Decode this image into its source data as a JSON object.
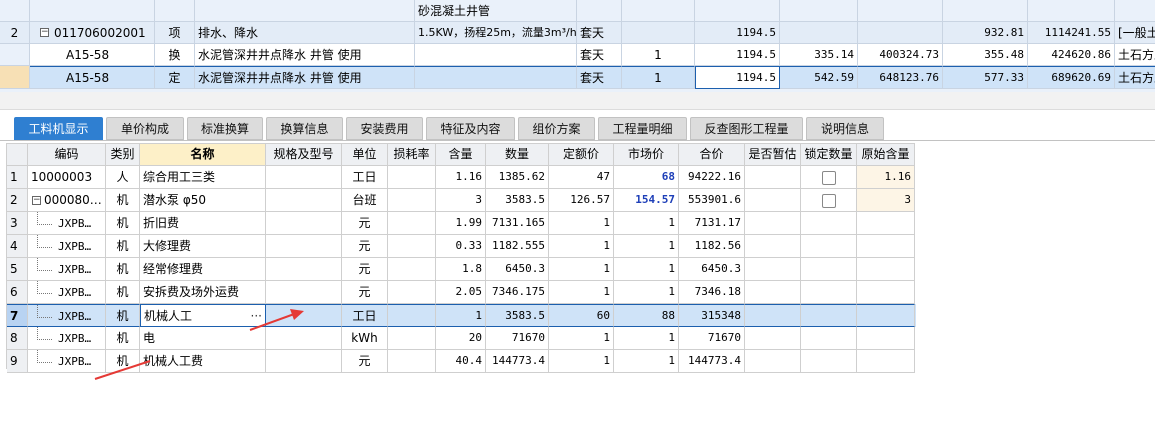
{
  "top_grid": {
    "partial_row": {
      "desc": "砂混凝土井管"
    },
    "rows": [
      {
        "num": "2",
        "code": "011706002001",
        "type": "项",
        "name": "排水、降水",
        "desc": "1.5KW，扬程25m，流量3m³/h",
        "unit": "套天",
        "qty": "",
        "amount": "1194.5",
        "c1": "",
        "c2": "",
        "c3": "932.81",
        "c4": "1114241.55",
        "c5": "[一般土"
      },
      {
        "num": "",
        "code": "A15-58",
        "type": "换",
        "name": "水泥管深井井点降水 井管 使用",
        "desc": "",
        "unit": "套天",
        "qty": "1",
        "amount": "1194.5",
        "c1": "335.14",
        "c2": "400324.73",
        "c3": "355.48",
        "c4": "424620.86",
        "c5": "土石方工"
      },
      {
        "num": "",
        "code": "A15-58",
        "type": "定",
        "name": "水泥管深井井点降水 井管 使用",
        "desc": "",
        "unit": "套天",
        "qty": "1",
        "amount": "1194.5",
        "c1": "542.59",
        "c2": "648123.76",
        "c3": "577.33",
        "c4": "689620.69",
        "c5": "土石方工"
      }
    ]
  },
  "tabs": [
    "工料机显示",
    "单价构成",
    "标准换算",
    "换算信息",
    "安装费用",
    "特征及内容",
    "组价方案",
    "工程量明细",
    "反查图形工程量",
    "说明信息"
  ],
  "active_tab": 0,
  "table": {
    "headers": [
      "编码",
      "类别",
      "名称",
      "规格及型号",
      "单位",
      "损耗率",
      "含量",
      "数量",
      "定额价",
      "市场价",
      "合价",
      "是否暂估",
      "锁定数量",
      "原始含量"
    ],
    "rows": [
      {
        "num": "1",
        "code": "10000003",
        "type": "人",
        "name": "综合用工三类",
        "spec": "",
        "unit": "工日",
        "loss": "",
        "content": "1.16",
        "qty": "1385.62",
        "base": "47",
        "market": "68",
        "total": "94222.16",
        "temp": "",
        "lock": true,
        "orig": "1.16"
      },
      {
        "num": "2",
        "code": "000080…",
        "type": "机",
        "name": "潜水泵 φ50",
        "spec": "",
        "unit": "台班",
        "loss": "",
        "content": "3",
        "qty": "3583.5",
        "base": "126.57",
        "market": "154.57",
        "total": "553901.6",
        "temp": "",
        "lock": true,
        "orig": "3"
      },
      {
        "num": "3",
        "code": "JXPB…",
        "type": "机",
        "name": "折旧费",
        "spec": "",
        "unit": "元",
        "loss": "",
        "content": "1.99",
        "qty": "7131.165",
        "base": "1",
        "market": "1",
        "total": "7131.17",
        "temp": "",
        "lock": false,
        "orig": ""
      },
      {
        "num": "4",
        "code": "JXPB…",
        "type": "机",
        "name": "大修理费",
        "spec": "",
        "unit": "元",
        "loss": "",
        "content": "0.33",
        "qty": "1182.555",
        "base": "1",
        "market": "1",
        "total": "1182.56",
        "temp": "",
        "lock": false,
        "orig": ""
      },
      {
        "num": "5",
        "code": "JXPB…",
        "type": "机",
        "name": "经常修理费",
        "spec": "",
        "unit": "元",
        "loss": "",
        "content": "1.8",
        "qty": "6450.3",
        "base": "1",
        "market": "1",
        "total": "6450.3",
        "temp": "",
        "lock": false,
        "orig": ""
      },
      {
        "num": "6",
        "code": "JXPB…",
        "type": "机",
        "name": "安拆费及场外运费",
        "spec": "",
        "unit": "元",
        "loss": "",
        "content": "2.05",
        "qty": "7346.175",
        "base": "1",
        "market": "1",
        "total": "7346.18",
        "temp": "",
        "lock": false,
        "orig": ""
      },
      {
        "num": "7",
        "code": "JXPB…",
        "type": "机",
        "name": "机械人工",
        "spec": "",
        "unit": "工日",
        "loss": "",
        "content": "1",
        "qty": "3583.5",
        "base": "60",
        "market": "88",
        "total": "315348",
        "temp": "",
        "lock": false,
        "orig": ""
      },
      {
        "num": "8",
        "code": "JXPB…",
        "type": "机",
        "name": "电",
        "spec": "",
        "unit": "kWh",
        "loss": "",
        "content": "20",
        "qty": "71670",
        "base": "1",
        "market": "1",
        "total": "71670",
        "temp": "",
        "lock": false,
        "orig": ""
      },
      {
        "num": "9",
        "code": "JXPB…",
        "type": "机",
        "name": "机械人工费",
        "spec": "",
        "unit": "元",
        "loss": "",
        "content": "40.4",
        "qty": "144773.4",
        "base": "1",
        "market": "1",
        "total": "144773.4",
        "temp": "",
        "lock": false,
        "orig": ""
      }
    ],
    "selected_row": 6,
    "ellipsis": "···"
  },
  "colors": {
    "accent": "#2f7fd1",
    "selection": "#cfe3f8",
    "arrow": "#e53935",
    "market_highlight": "#1e3fb8"
  }
}
